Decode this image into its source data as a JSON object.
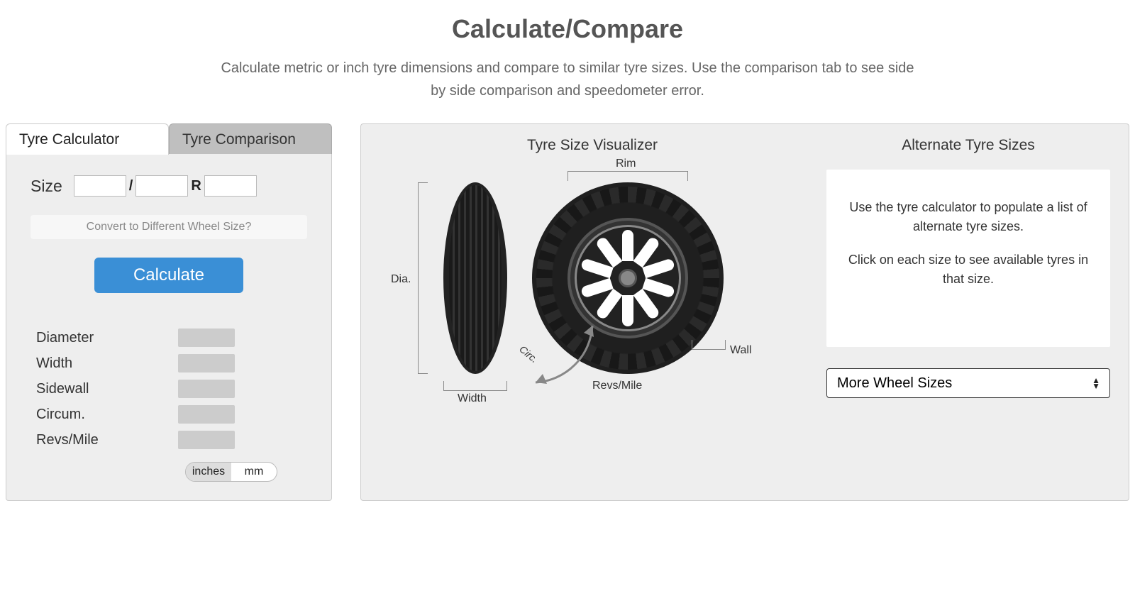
{
  "header": {
    "title": "Calculate/Compare",
    "subtitle": "Calculate metric or inch tyre dimensions and compare to similar tyre sizes. Use the comparison tab to see side by side comparison and speedometer error."
  },
  "tabs": {
    "calculator": "Tyre Calculator",
    "comparison": "Tyre Comparison"
  },
  "form": {
    "size_label": "Size",
    "sep_slash": "/",
    "sep_r": "R",
    "convert_link": "Convert to Different Wheel Size?",
    "calculate_btn": "Calculate"
  },
  "results": {
    "diameter": "Diameter",
    "width": "Width",
    "sidewall": "Sidewall",
    "circum": "Circum.",
    "revs": "Revs/Mile"
  },
  "units": {
    "inches": "inches",
    "mm": "mm",
    "active": "inches"
  },
  "viz": {
    "title": "Tyre Size Visualizer",
    "labels": {
      "dia": "Dia.",
      "width": "Width",
      "rim": "Rim",
      "wall": "Wall",
      "revs": "Revs/Mile",
      "circ": "Circ."
    }
  },
  "alt": {
    "title": "Alternate Tyre Sizes",
    "line1": "Use the tyre calculator to populate a list of alternate tyre sizes.",
    "line2": "Click on each size to see available tyres in that size.",
    "select_label": "More Wheel Sizes"
  }
}
